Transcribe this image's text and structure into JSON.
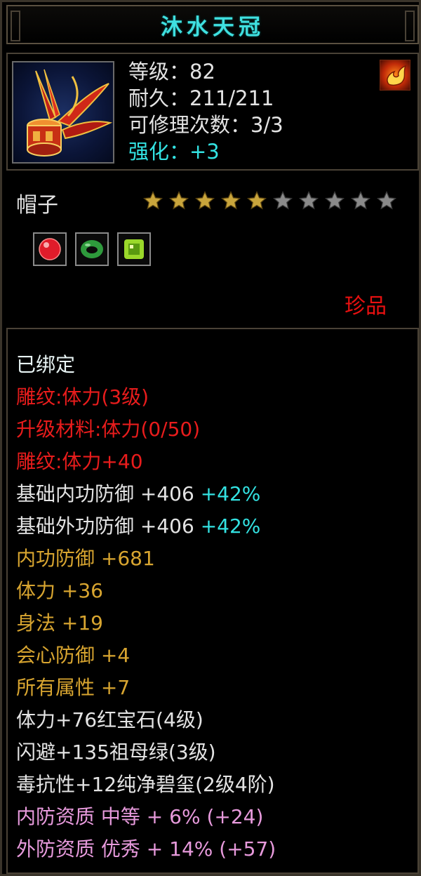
{
  "item": {
    "name": "沐水天冠",
    "icon": "hat-icon",
    "badge_icon": "fire-badge-icon",
    "stats": {
      "level": "等级：82",
      "durability": "耐久：211/211",
      "repair": "可修理次数：3/3",
      "enhance": "强化：+3"
    },
    "type": "帽子",
    "stars": {
      "filled": 5,
      "total": 10
    },
    "gems": [
      {
        "icon": "red-gem-icon",
        "color": "#e01c2a"
      },
      {
        "icon": "green-jade-ring-icon",
        "color": "#2e9a3c"
      },
      {
        "icon": "green-crystal-icon",
        "color": "#9ad82a"
      }
    ],
    "rarity": "珍品"
  },
  "attributes": {
    "bound": "已绑定",
    "carve1": "雕纹:体力(3级)",
    "upgrade": "升级材料:体力(0/50)",
    "carve2": "雕纹:体力+40",
    "base_inner": {
      "label": "基础内功防御 +406",
      "pct": "+42%"
    },
    "base_outer": {
      "label": "基础外功防御 +406",
      "pct": "+42%"
    },
    "inner_def": "内功防御 +681",
    "stamina": "体力 +36",
    "agility": "身法 +19",
    "crit_def": "会心防御 +4",
    "all_attr": "所有属性 +7",
    "gem1": "体力+76红宝石(4级)",
    "gem2": "闪避+135祖母绿(3级)",
    "gem3": "毒抗性+12纯净碧玺(2级4阶)",
    "quality_inner": "内防资质 中等 + 6% (+24)",
    "quality_outer": "外防资质 优秀 + 14% (+57)"
  },
  "colors": {
    "title": "#3fe0e0",
    "red": "#e81c1c",
    "gold": "#d8a530",
    "pink": "#e79adc",
    "cyan": "#33e2e2"
  }
}
